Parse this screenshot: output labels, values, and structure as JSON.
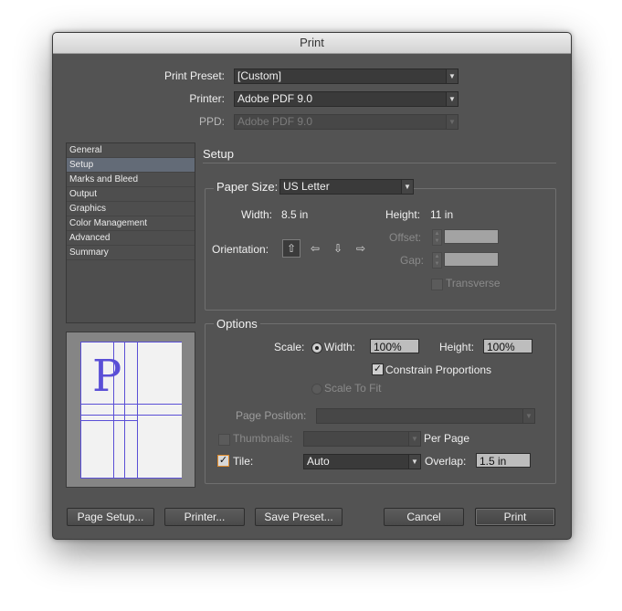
{
  "window": {
    "title": "Print"
  },
  "top": {
    "preset_label": "Print Preset:",
    "preset_value": "[Custom]",
    "printer_label": "Printer:",
    "printer_value": "Adobe PDF 9.0",
    "ppd_label": "PPD:",
    "ppd_value": "Adobe PDF 9.0"
  },
  "sidebar": {
    "items": [
      "General",
      "Setup",
      "Marks and Bleed",
      "Output",
      "Graphics",
      "Color Management",
      "Advanced",
      "Summary"
    ],
    "selected": "Setup"
  },
  "setup": {
    "heading": "Setup",
    "paper_size_label": "Paper Size:",
    "paper_size_value": "US Letter",
    "width_label": "Width:",
    "width_value": "8.5 in",
    "height_label": "Height:",
    "height_value": "11 in",
    "orientation_label": "Orientation:",
    "offset_label": "Offset:",
    "gap_label": "Gap:",
    "transverse_label": "Transverse"
  },
  "preview": {
    "glyph": "P"
  },
  "options": {
    "legend": "Options",
    "scale_label": "Scale:",
    "width_label": "Width:",
    "width_value": "100%",
    "height_label": "Height:",
    "height_value": "100%",
    "constrain_label": "Constrain Proportions",
    "scale_to_fit_label": "Scale To Fit",
    "page_position_label": "Page Position:",
    "thumbnails_label": "Thumbnails:",
    "per_page_label": "Per Page",
    "tile_label": "Tile:",
    "tile_value": "Auto",
    "overlap_label": "Overlap:",
    "overlap_value": "1.5 in"
  },
  "buttons": {
    "page_setup": "Page Setup...",
    "printer": "Printer...",
    "save_preset": "Save Preset...",
    "cancel": "Cancel",
    "print": "Print"
  },
  "icons": {
    "dropdown": "dropdown-arrow-icon",
    "checkmark": "checkmark-icon",
    "spin": "spin-arrows-icon",
    "orientation": [
      "portrait-icon",
      "landscape-icon",
      "reverse-portrait-icon",
      "reverse-landscape-icon"
    ]
  },
  "colors": {
    "dialog_bg": "#535353",
    "selection": "#636b77",
    "guide_lines": "#5a4fd6",
    "tile_checkbox_focus": "#e08b2c"
  }
}
